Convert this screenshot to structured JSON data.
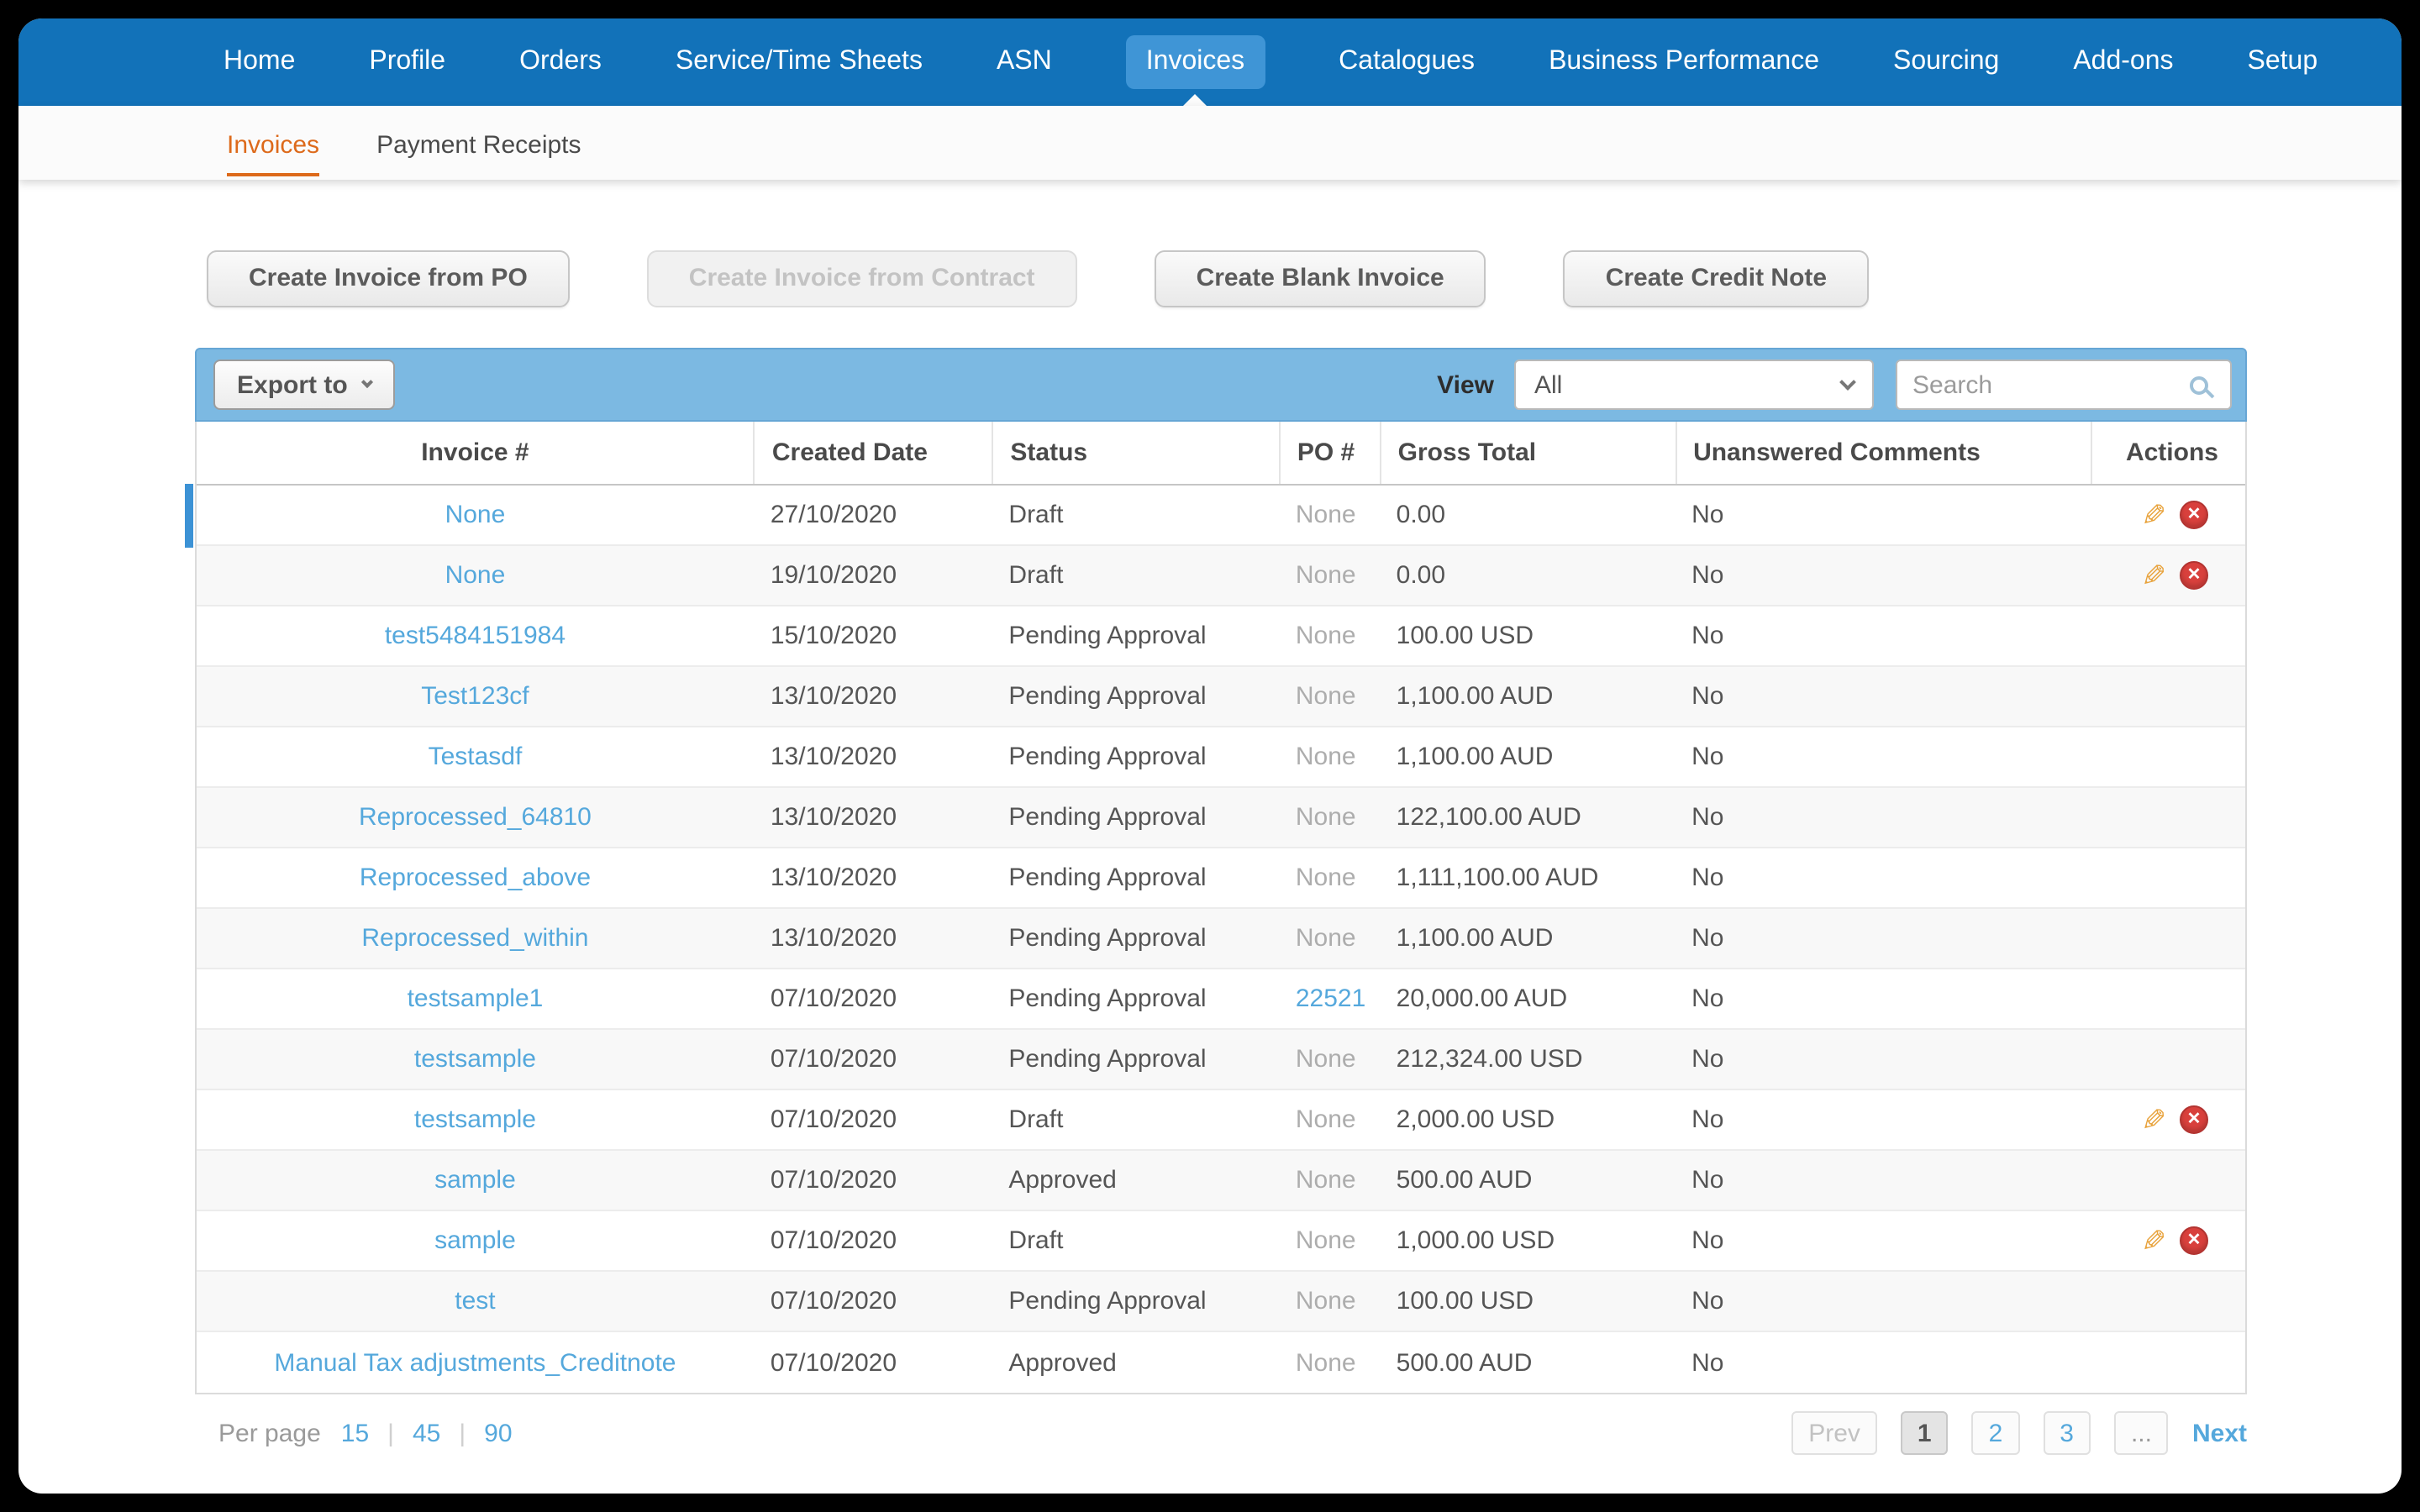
{
  "colors": {
    "nav_blue": "#1272B9",
    "nav_active_blue": "#3F95D6",
    "toolbar_blue": "#7CB9E2",
    "link_blue": "#55A8DC",
    "accent_orange": "#DD6A1B",
    "pencil_orange": "#E8A33D",
    "delete_red": "#D8403C",
    "selected_row_bar": "#3C92D5"
  },
  "nav": {
    "items": [
      {
        "label": "Home",
        "active": false
      },
      {
        "label": "Profile",
        "active": false
      },
      {
        "label": "Orders",
        "active": false
      },
      {
        "label": "Service/Time Sheets",
        "active": false
      },
      {
        "label": "ASN",
        "active": false
      },
      {
        "label": "Invoices",
        "active": true
      },
      {
        "label": "Catalogues",
        "active": false
      },
      {
        "label": "Business Performance",
        "active": false
      },
      {
        "label": "Sourcing",
        "active": false
      },
      {
        "label": "Add-ons",
        "active": false
      },
      {
        "label": "Setup",
        "active": false
      }
    ]
  },
  "subnav": {
    "items": [
      {
        "label": "Invoices",
        "active": true
      },
      {
        "label": "Payment Receipts",
        "active": false
      }
    ]
  },
  "action_buttons": [
    {
      "label": "Create Invoice from PO",
      "enabled": true
    },
    {
      "label": "Create Invoice from Contract",
      "enabled": false
    },
    {
      "label": "Create Blank Invoice",
      "enabled": true
    },
    {
      "label": "Create Credit Note",
      "enabled": true
    }
  ],
  "toolbar": {
    "export_label": "Export to",
    "view_label": "View",
    "view_selected": "All",
    "search_placeholder": "Search"
  },
  "icons": {
    "edit": "✎",
    "delete": "✕"
  },
  "table": {
    "columns": [
      "Invoice #",
      "Created Date",
      "Status",
      "PO #",
      "Gross Total",
      "Unanswered Comments",
      "Actions"
    ],
    "rows": [
      {
        "invoice": "None",
        "created": "27/10/2020",
        "status": "Draft",
        "po": "None",
        "po_is_link": false,
        "gross": "0.00",
        "comments": "No",
        "has_actions": true,
        "selected": true
      },
      {
        "invoice": "None",
        "created": "19/10/2020",
        "status": "Draft",
        "po": "None",
        "po_is_link": false,
        "gross": "0.00",
        "comments": "No",
        "has_actions": true,
        "selected": false
      },
      {
        "invoice": "test5484151984",
        "created": "15/10/2020",
        "status": "Pending Approval",
        "po": "None",
        "po_is_link": false,
        "gross": "100.00 USD",
        "comments": "No",
        "has_actions": false,
        "selected": false
      },
      {
        "invoice": "Test123cf",
        "created": "13/10/2020",
        "status": "Pending Approval",
        "po": "None",
        "po_is_link": false,
        "gross": "1,100.00 AUD",
        "comments": "No",
        "has_actions": false,
        "selected": false
      },
      {
        "invoice": "Testasdf",
        "created": "13/10/2020",
        "status": "Pending Approval",
        "po": "None",
        "po_is_link": false,
        "gross": "1,100.00 AUD",
        "comments": "No",
        "has_actions": false,
        "selected": false
      },
      {
        "invoice": "Reprocessed_64810",
        "created": "13/10/2020",
        "status": "Pending Approval",
        "po": "None",
        "po_is_link": false,
        "gross": "122,100.00 AUD",
        "comments": "No",
        "has_actions": false,
        "selected": false
      },
      {
        "invoice": "Reprocessed_above",
        "created": "13/10/2020",
        "status": "Pending Approval",
        "po": "None",
        "po_is_link": false,
        "gross": "1,111,100.00 AUD",
        "comments": "No",
        "has_actions": false,
        "selected": false
      },
      {
        "invoice": "Reprocessed_within",
        "created": "13/10/2020",
        "status": "Pending Approval",
        "po": "None",
        "po_is_link": false,
        "gross": "1,100.00 AUD",
        "comments": "No",
        "has_actions": false,
        "selected": false
      },
      {
        "invoice": "testsample1",
        "created": "07/10/2020",
        "status": "Pending Approval",
        "po": "22521",
        "po_is_link": true,
        "gross": "20,000.00 AUD",
        "comments": "No",
        "has_actions": false,
        "selected": false
      },
      {
        "invoice": "testsample",
        "created": "07/10/2020",
        "status": "Pending Approval",
        "po": "None",
        "po_is_link": false,
        "gross": "212,324.00 USD",
        "comments": "No",
        "has_actions": false,
        "selected": false
      },
      {
        "invoice": "testsample",
        "created": "07/10/2020",
        "status": "Draft",
        "po": "None",
        "po_is_link": false,
        "gross": "2,000.00 USD",
        "comments": "No",
        "has_actions": true,
        "selected": false
      },
      {
        "invoice": "sample",
        "created": "07/10/2020",
        "status": "Approved",
        "po": "None",
        "po_is_link": false,
        "gross": "500.00 AUD",
        "comments": "No",
        "has_actions": false,
        "selected": false
      },
      {
        "invoice": "sample",
        "created": "07/10/2020",
        "status": "Draft",
        "po": "None",
        "po_is_link": false,
        "gross": "1,000.00 USD",
        "comments": "No",
        "has_actions": true,
        "selected": false
      },
      {
        "invoice": "test",
        "created": "07/10/2020",
        "status": "Pending Approval",
        "po": "None",
        "po_is_link": false,
        "gross": "100.00 USD",
        "comments": "No",
        "has_actions": false,
        "selected": false
      },
      {
        "invoice": "Manual Tax adjustments_Creditnote",
        "created": "07/10/2020",
        "status": "Approved",
        "po": "None",
        "po_is_link": false,
        "gross": "500.00 AUD",
        "comments": "No",
        "has_actions": false,
        "selected": false
      }
    ]
  },
  "footer": {
    "per_page_label": "Per page",
    "per_page_options": [
      "15",
      "45",
      "90"
    ],
    "per_page_separator": "|",
    "pagination": {
      "prev_label": "Prev",
      "pages": [
        "1",
        "2",
        "3"
      ],
      "current": "1",
      "ellipsis": "...",
      "next_label": "Next"
    }
  }
}
